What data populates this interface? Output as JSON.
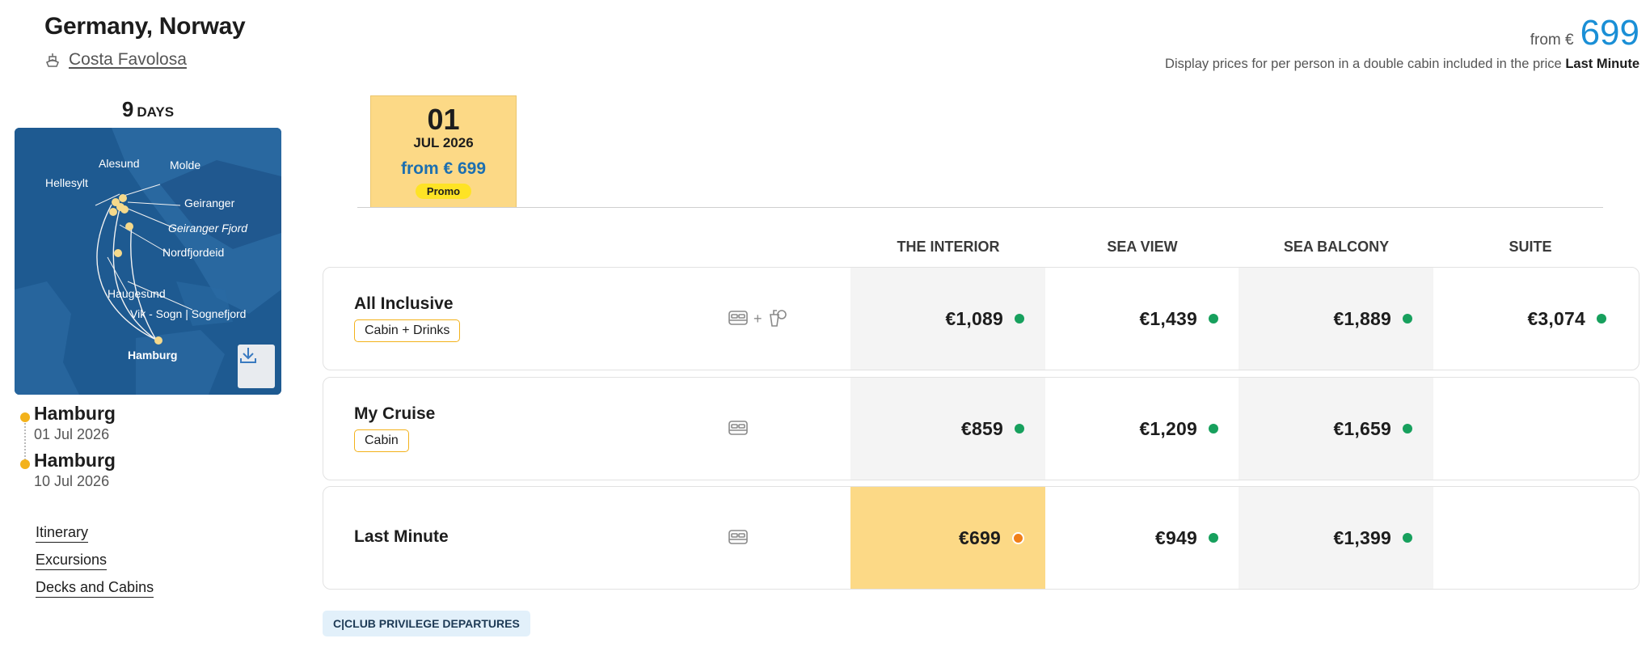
{
  "header": {
    "title": "Germany, Norway",
    "ship": "Costa Favolosa",
    "price_from_label": "from €",
    "price_from_value": "699",
    "disclaimer": "Display prices for per person in a double cabin included in the price",
    "disclaimer_bold": "Last Minute"
  },
  "duration": {
    "number": "9",
    "unit": "DAYS"
  },
  "map": {
    "labels": {
      "alesund": "Alesund",
      "molde": "Molde",
      "hellesylt": "Hellesylt",
      "geiranger": "Geiranger",
      "geiranger_fjord": "Geiranger Fjord",
      "nordfjordeid": "Nordfjordeid",
      "haugesund": "Haugesund",
      "vik": "Vik - Sogn | Sognefjord",
      "hamburg": "Hamburg"
    }
  },
  "stops": [
    {
      "name": "Hamburg",
      "date": "01 Jul 2026"
    },
    {
      "name": "Hamburg",
      "date": "10 Jul 2026"
    }
  ],
  "links": [
    "Itinerary",
    "Excursions",
    "Decks and Cabins"
  ],
  "departure": {
    "day": "01",
    "month": "JUL 2026",
    "price": "from € 699",
    "badge": "Promo"
  },
  "columns": [
    "THE INTERIOR",
    "SEA VIEW",
    "SEA BALCONY",
    "SUITE"
  ],
  "rows": [
    {
      "name": "All Inclusive",
      "badge": "Cabin + Drinks",
      "icons": "+",
      "prices": [
        "€1,089",
        "€1,439",
        "€1,889",
        "€3,074"
      ]
    },
    {
      "name": "My Cruise",
      "badge": "Cabin",
      "prices": [
        "€859",
        "€1,209",
        "€1,659"
      ]
    },
    {
      "name": "Last Minute",
      "prices": [
        "€699",
        "€949",
        "€1,399"
      ]
    }
  ],
  "club": "C|CLUB PRIVILEGE DEPARTURES",
  "colors": {
    "accent_yellow": "#fcd986",
    "price_blue": "#1a8fd6",
    "status_green": "#17a05d",
    "status_orange": "#f07f19"
  }
}
